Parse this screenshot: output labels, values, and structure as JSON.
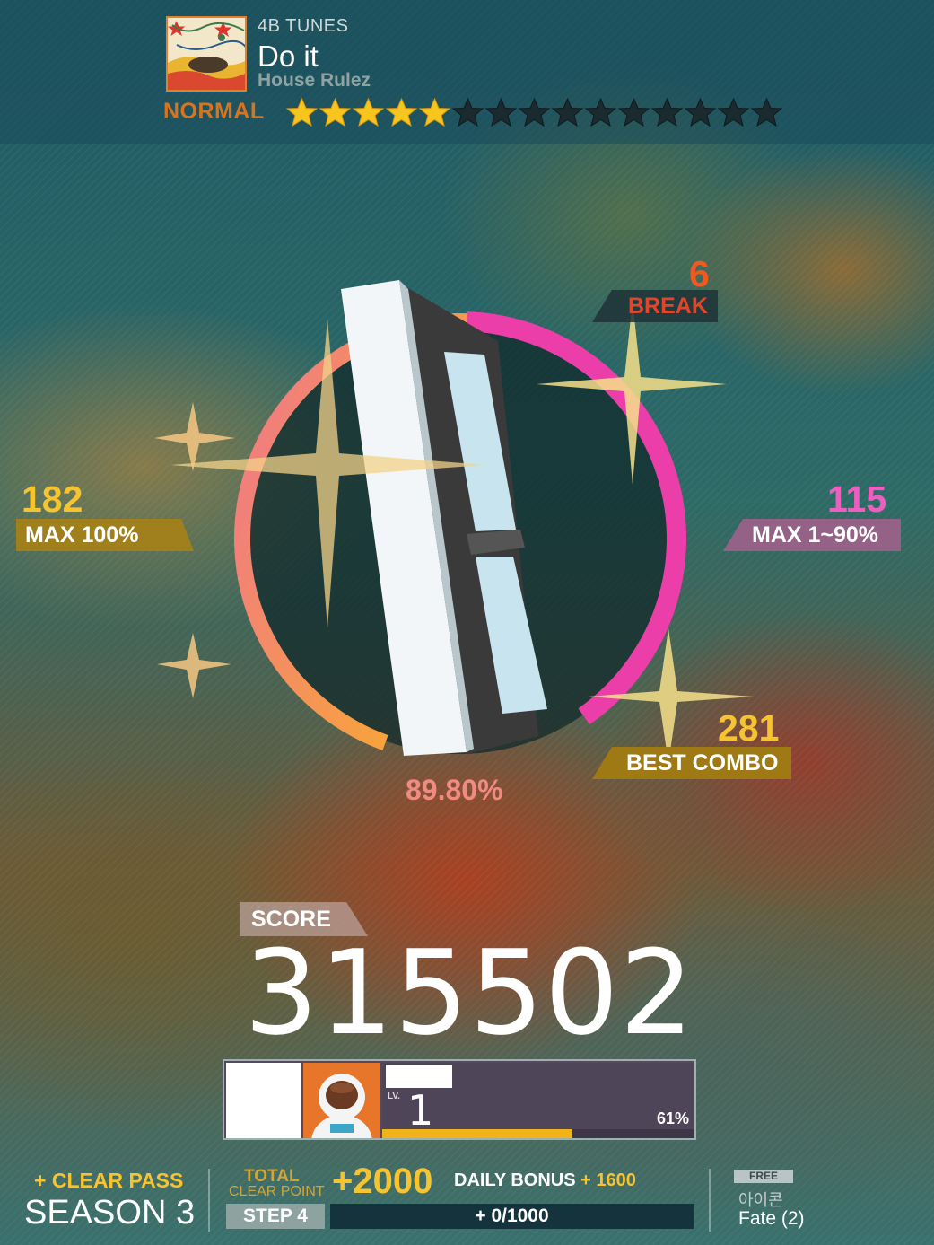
{
  "song": {
    "pack": "4B TUNES",
    "title": "Do it",
    "artist": "House Rulez",
    "difficulty": "NORMAL",
    "difficulty_level": 5,
    "difficulty_max": 15
  },
  "colors": {
    "perfect": "#f6c431",
    "great": "#ec5fbe",
    "break": "#ef5a24",
    "difficulty": "#d9741c"
  },
  "judgement": {
    "break_count": "6",
    "break_label": "BREAK",
    "perfect_count": "182",
    "perfect_label": "MAX 100%",
    "great_count": "115",
    "great_label": "MAX 1~90%",
    "best_combo": "281",
    "best_combo_label": "BEST COMBO",
    "rate": "89.80%",
    "rate_value": 89.8
  },
  "rank_icon": "rank-b-icon",
  "score": {
    "label": "SCORE",
    "value": "315502"
  },
  "player": {
    "avatar_icon": "astronaut-icon",
    "level_label": "LV.",
    "level": "1",
    "xp_percent_text": "61%",
    "xp_fraction": 0.61
  },
  "clear_pass": {
    "label": "CLEAR PASS",
    "season": "SEASON 3",
    "step": "STEP 4",
    "progress": "0/1000",
    "total_clear_point_line1": "TOTAL",
    "total_clear_point_line2": "CLEAR POINT",
    "points_gained": "+2000",
    "daily_bonus_label": "DAILY BONUS",
    "daily_bonus_value": "1600"
  },
  "reward": {
    "badge": "FREE",
    "type": "아이콘",
    "name": "Fate (2)"
  }
}
